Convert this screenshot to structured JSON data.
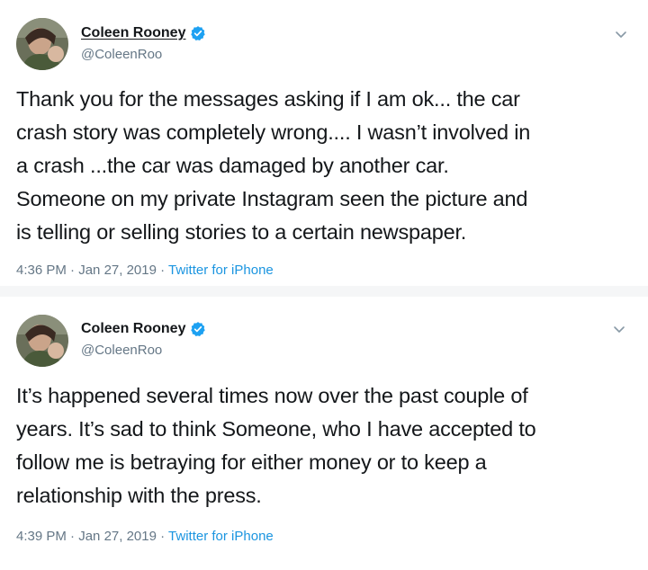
{
  "tweets": [
    {
      "name": "Coleen Rooney",
      "handle": "@ColeenRoo",
      "text": "Thank you for the messages asking if I am ok... the car\ncrash story was completely wrong.... I wasn’t involved in\na crash ...the car was damaged by another car.\nSomeone on my private Instagram seen the picture and\nis telling or selling stories to a certain newspaper.",
      "time": "4:36 PM",
      "date": "Jan 27, 2019",
      "source": "Twitter for iPhone"
    },
    {
      "name": "Coleen Rooney",
      "handle": "@ColeenRoo",
      "text": "It’s happened several times now over the past couple of\nyears. It’s sad to think Someone, who I have accepted to\nfollow me is betraying for either money or to keep a\nrelationship with the press.",
      "time": "4:39 PM",
      "date": "Jan 27, 2019",
      "source": "Twitter for iPhone"
    }
  ],
  "meta_separator": " · ",
  "colors": {
    "verified": "#1da1f2",
    "link": "#1b95e0",
    "muted": "#657786",
    "text": "#14171a"
  },
  "icons": [
    "avatar",
    "verified-badge-icon",
    "chevron-down-icon"
  ]
}
